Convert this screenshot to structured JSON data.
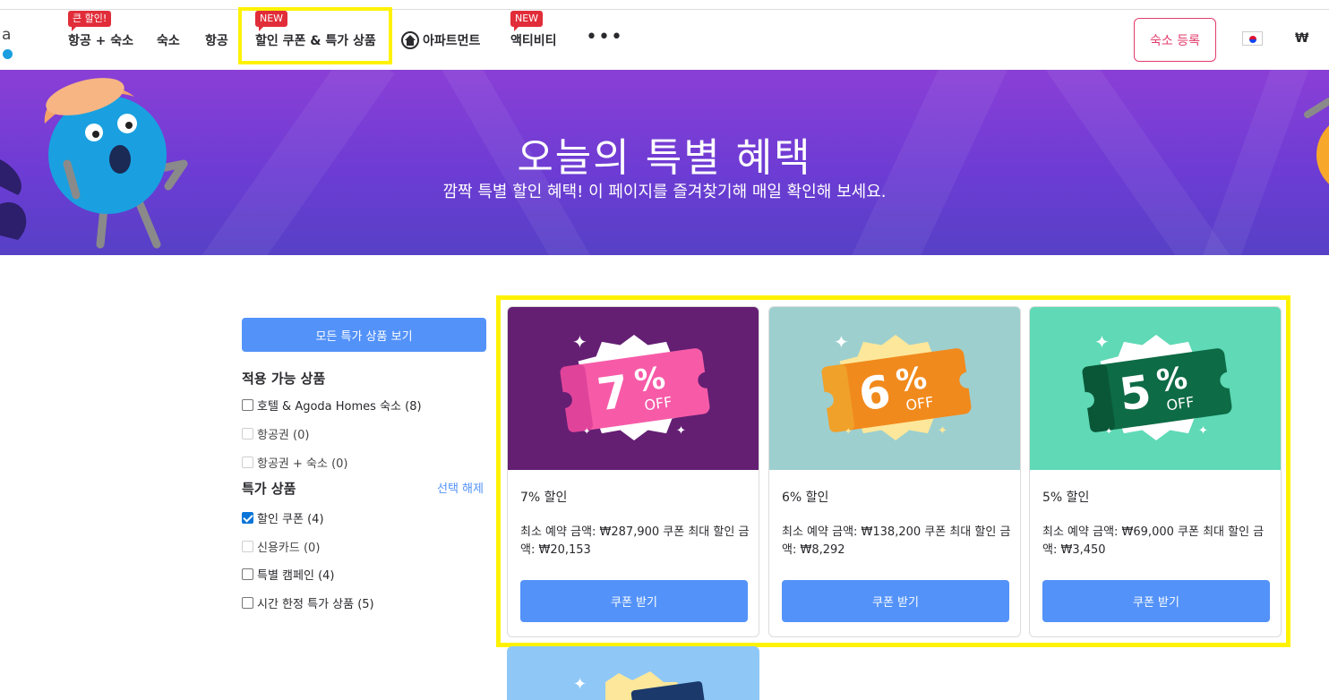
{
  "nav": {
    "items": [
      {
        "label": "항공 + 숙소",
        "badge": "큰 할인!"
      },
      {
        "label": "숙소"
      },
      {
        "label": "항공"
      },
      {
        "label": "할인 쿠폰 & 특가 상품",
        "badge": "NEW"
      },
      {
        "label": "아파트먼트"
      },
      {
        "label": "액티비티",
        "badge": "NEW"
      }
    ],
    "more": "•••",
    "list_property": "숙소 등록",
    "currency": "₩"
  },
  "banner": {
    "title": "오늘의 특별 혜택",
    "subtitle": "깜짝 특별 할인 혜택! 이 페이지를 즐겨찾기해 매일 확인해 보세요."
  },
  "sidebar": {
    "all_deals": "모든 특가 상품 보기",
    "applicable_title": "적용 가능 상품",
    "applicable": [
      {
        "label": "호텔 & Agoda Homes 숙소 (8)",
        "checked": false
      },
      {
        "label": "항공권 (0)",
        "checked": false
      },
      {
        "label": "항공권 + 숙소 (0)",
        "checked": false
      }
    ],
    "deals_title": "특가 상품",
    "clear": "선택 해제",
    "deals": [
      {
        "label": "할인 쿠폰 (4)",
        "checked": true
      },
      {
        "label": "신용카드 (0)",
        "checked": false
      },
      {
        "label": "특별 캠페인 (4)",
        "checked": false
      },
      {
        "label": "시간 한정 특가 상품 (5)",
        "checked": false
      }
    ]
  },
  "cards": [
    {
      "percent": "7%",
      "off": "OFF",
      "title": "7% 할인",
      "desc": "최소 예약 금액: ₩287,900 쿠폰 최대 할인 금액: ₩20,153",
      "button": "쿠폰 받기",
      "bg": "#641f73",
      "ticket": "#f75ba8",
      "ticket_dark": "#e0449a",
      "burst": "#ffffff"
    },
    {
      "percent": "6%",
      "off": "OFF",
      "title": "6% 할인",
      "desc": "최소 예약 금액: ₩138,200 쿠폰 최대 할인 금액: ₩8,292",
      "button": "쿠폰 받기",
      "bg": "#9dcfcf",
      "ticket": "#f18a1d",
      "ticket_dark": "#f0a12a",
      "burst": "#fde79a"
    },
    {
      "percent": "5%",
      "off": "OFF",
      "title": "5% 할인",
      "desc": "최소 예약 금액: ₩69,000 쿠폰 최대 할인 금액: ₩3,450",
      "button": "쿠폰 받기",
      "bg": "#5fd9b6",
      "ticket": "#0d6b45",
      "ticket_dark": "#0a5738",
      "burst": "#ffffff"
    }
  ],
  "accent": {
    "primary": "#5392f9",
    "highlight": "#fff200",
    "badge": "#e12d39",
    "pink": "#e23b6b"
  }
}
